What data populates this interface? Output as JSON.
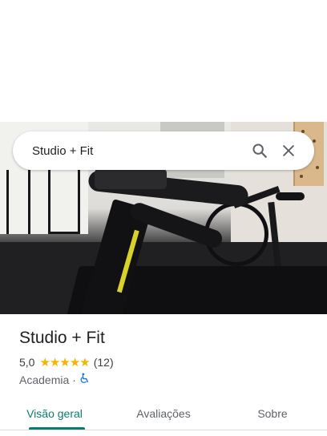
{
  "search": {
    "query": "Studio + Fit",
    "search_icon": "search-icon",
    "close_icon": "close-icon"
  },
  "place": {
    "name": "Studio + Fit",
    "rating": "5,0",
    "stars": 5,
    "review_count": "(12)",
    "category": "Academia",
    "separator": "·",
    "accessibility_icon": "wheelchair-icon"
  },
  "tabs": [
    {
      "label": "Visão geral",
      "active": true
    },
    {
      "label": "Avaliações",
      "active": false
    },
    {
      "label": "Sobre",
      "active": false
    }
  ],
  "colors": {
    "accent": "#0b7b72",
    "star": "#f4b400",
    "accessibility": "#1a73e8"
  }
}
